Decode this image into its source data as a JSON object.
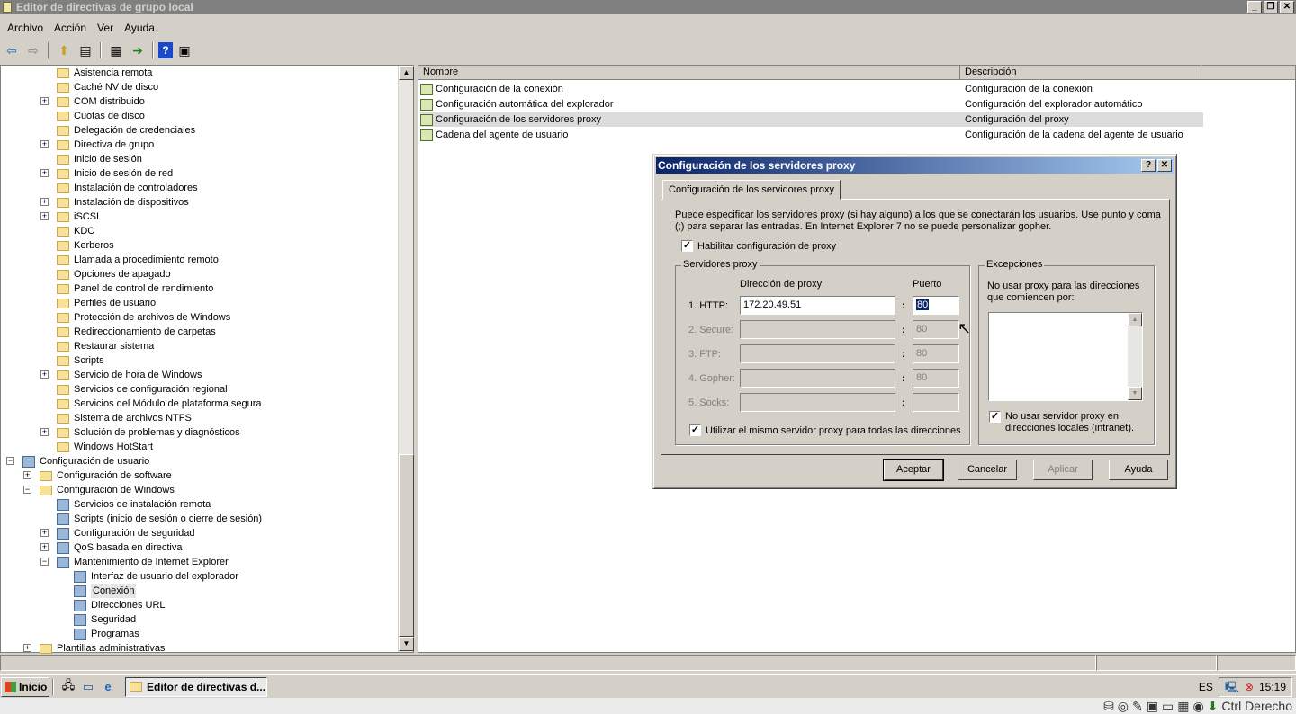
{
  "window": {
    "title": "Editor de directivas de grupo local",
    "buttons": [
      "_",
      "❐",
      "✕"
    ]
  },
  "menu": [
    "Archivo",
    "Acción",
    "Ver",
    "Ayuda"
  ],
  "tree": {
    "items": [
      {
        "label": "Asistencia remota",
        "level": 2,
        "expander": false,
        "icon": "folder-icon"
      },
      {
        "label": "Caché NV de disco",
        "level": 2,
        "expander": false,
        "icon": "folder-icon"
      },
      {
        "label": "COM distribuido",
        "level": 2,
        "expander": true,
        "icon": "folder-icon"
      },
      {
        "label": "Cuotas de disco",
        "level": 2,
        "expander": false,
        "icon": "folder-icon"
      },
      {
        "label": "Delegación de credenciales",
        "level": 2,
        "expander": false,
        "icon": "folder-icon"
      },
      {
        "label": "Directiva de grupo",
        "level": 2,
        "expander": true,
        "icon": "folder-icon"
      },
      {
        "label": "Inicio de sesión",
        "level": 2,
        "expander": false,
        "icon": "folder-icon"
      },
      {
        "label": "Inicio de sesión de red",
        "level": 2,
        "expander": true,
        "icon": "folder-icon"
      },
      {
        "label": "Instalación de controladores",
        "level": 2,
        "expander": false,
        "icon": "folder-icon"
      },
      {
        "label": "Instalación de dispositivos",
        "level": 2,
        "expander": true,
        "icon": "folder-icon"
      },
      {
        "label": "iSCSI",
        "level": 2,
        "expander": true,
        "icon": "folder-icon"
      },
      {
        "label": "KDC",
        "level": 2,
        "expander": false,
        "icon": "folder-icon"
      },
      {
        "label": "Kerberos",
        "level": 2,
        "expander": false,
        "icon": "folder-icon"
      },
      {
        "label": "Llamada a procedimiento remoto",
        "level": 2,
        "expander": false,
        "icon": "folder-icon"
      },
      {
        "label": "Opciones de apagado",
        "level": 2,
        "expander": false,
        "icon": "folder-icon"
      },
      {
        "label": "Panel de control de rendimiento",
        "level": 2,
        "expander": false,
        "icon": "folder-icon"
      },
      {
        "label": "Perfiles de usuario",
        "level": 2,
        "expander": false,
        "icon": "folder-icon"
      },
      {
        "label": "Protección de archivos de Windows",
        "level": 2,
        "expander": false,
        "icon": "folder-icon"
      },
      {
        "label": "Redireccionamiento de carpetas",
        "level": 2,
        "expander": false,
        "icon": "folder-icon"
      },
      {
        "label": "Restaurar sistema",
        "level": 2,
        "expander": false,
        "icon": "folder-icon"
      },
      {
        "label": "Scripts",
        "level": 2,
        "expander": false,
        "icon": "folder-icon"
      },
      {
        "label": "Servicio de hora de Windows",
        "level": 2,
        "expander": true,
        "icon": "folder-icon"
      },
      {
        "label": "Servicios de configuración regional",
        "level": 2,
        "expander": false,
        "icon": "folder-icon"
      },
      {
        "label": "Servicios del Módulo de plataforma segura",
        "level": 2,
        "expander": false,
        "icon": "folder-icon"
      },
      {
        "label": "Sistema de archivos NTFS",
        "level": 2,
        "expander": false,
        "icon": "folder-icon"
      },
      {
        "label": "Solución de problemas y diagnósticos",
        "level": 2,
        "expander": true,
        "icon": "folder-icon"
      },
      {
        "label": "Windows HotStart",
        "level": 2,
        "expander": false,
        "icon": "folder-icon"
      },
      {
        "label": "Configuración de usuario",
        "level": 0,
        "expander": "minus",
        "icon": "user-config-icon"
      },
      {
        "label": "Configuración de software",
        "level": 1,
        "expander": true,
        "icon": "folder-icon"
      },
      {
        "label": "Configuración de Windows",
        "level": 1,
        "expander": "minus",
        "icon": "folder-icon"
      },
      {
        "label": "Servicios de instalación remota",
        "level": 2,
        "expander": false,
        "icon": "remote-install-icon"
      },
      {
        "label": "Scripts (inicio de sesión o cierre de sesión)",
        "level": 2,
        "expander": false,
        "icon": "script-icon"
      },
      {
        "label": "Configuración de seguridad",
        "level": 2,
        "expander": true,
        "icon": "security-icon"
      },
      {
        "label": "QoS basada en directiva",
        "level": 2,
        "expander": true,
        "icon": "qos-icon"
      },
      {
        "label": "Mantenimiento de Internet Explorer",
        "level": 2,
        "expander": "minus",
        "icon": "ie-maintenance-icon"
      },
      {
        "label": "Interfaz de usuario del explorador",
        "level": 3,
        "expander": false,
        "icon": "browser-ui-icon"
      },
      {
        "label": "Conexión",
        "level": 3,
        "expander": false,
        "icon": "connection-icon",
        "selected": true
      },
      {
        "label": "Direcciones URL",
        "level": 3,
        "expander": false,
        "icon": "url-icon"
      },
      {
        "label": "Seguridad",
        "level": 3,
        "expander": false,
        "icon": "lock-icon"
      },
      {
        "label": "Programas",
        "level": 3,
        "expander": false,
        "icon": "programs-icon"
      },
      {
        "label": "Plantillas administrativas",
        "level": 1,
        "expander": true,
        "icon": "folder-icon"
      }
    ]
  },
  "list": {
    "columns": [
      "Nombre",
      "Descripción"
    ],
    "rows": [
      {
        "name": "Configuración de la conexión",
        "desc": "Configuración de la conexión"
      },
      {
        "name": "Configuración automática del explorador",
        "desc": "Configuración del explorador automático"
      },
      {
        "name": "Configuración de los servidores proxy",
        "desc": "Configuración del proxy",
        "highlighted": true
      },
      {
        "name": "Cadena del agente de usuario",
        "desc": "Configuración de la cadena del agente de usuario"
      }
    ]
  },
  "dialog": {
    "title": "Configuración de los servidores proxy",
    "tab": "Configuración de los servidores proxy",
    "description": "Puede especificar los servidores proxy (si hay alguno) a los que se conectarán los usuarios. Use punto y coma (;) para separar las entradas. En Internet Explorer 7 no se puede personalizar gopher.",
    "enable_proxy": {
      "label": "Habilitar configuración de proxy",
      "checked": true
    },
    "servers": {
      "group_label": "Servidores proxy",
      "address_header": "Dirección de proxy",
      "port_header": "Puerto",
      "colon": ":",
      "rows": [
        {
          "label": "1. HTTP:",
          "address": "172.20.49.51",
          "port": "80",
          "enabled": true
        },
        {
          "label": "2. Secure:",
          "address": "",
          "port": "80",
          "enabled": false
        },
        {
          "label": "3. FTP:",
          "address": "",
          "port": "80",
          "enabled": false
        },
        {
          "label": "4. Gopher:",
          "address": "",
          "port": "80",
          "enabled": false
        },
        {
          "label": "5. Socks:",
          "address": "",
          "port": "",
          "enabled": false
        }
      ],
      "same_proxy": {
        "label": "Utilizar el mismo servidor proxy para todas las direcciones",
        "checked": true
      }
    },
    "exceptions": {
      "group_label": "Excepciones",
      "text": "No usar proxy para las direcciones que comiencen por:",
      "value": "",
      "no_local": {
        "label": "No usar servidor proxy en direcciones locales (intranet).",
        "checked": true
      }
    },
    "buttons": {
      "ok": "Aceptar",
      "cancel": "Cancelar",
      "apply": "Aplicar",
      "help": "Ayuda"
    },
    "help_button": "?",
    "close_button": "✕"
  },
  "taskbar": {
    "start": "Inicio",
    "task": "Editor de directivas d...",
    "lang": "ES",
    "time": "15:19"
  },
  "hostbar": {
    "label": "Ctrl Derecho"
  }
}
